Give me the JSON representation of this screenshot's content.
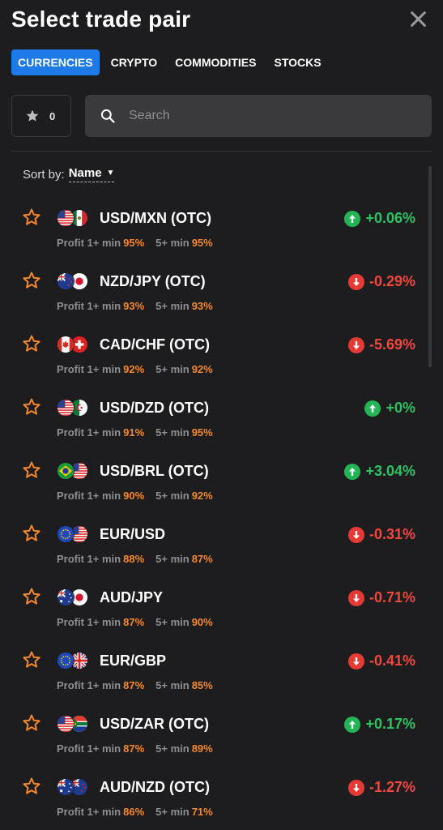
{
  "header": {
    "title": "Select trade pair"
  },
  "tabs": [
    {
      "label": "CURRENCIES",
      "active": true
    },
    {
      "label": "CRYPTO",
      "active": false
    },
    {
      "label": "COMMODITIES",
      "active": false
    },
    {
      "label": "STOCKS",
      "active": false
    }
  ],
  "favorites": {
    "count": "0"
  },
  "search": {
    "placeholder": "Search"
  },
  "sort": {
    "label": "Sort by:",
    "value": "Name"
  },
  "colors": {
    "accent": "#1d7ae6",
    "up": "#2ec262",
    "down": "#f2463f",
    "star": "#f5882c",
    "background": "#1d1d1f"
  },
  "pairs": [
    {
      "name": "USD/MXN (OTC)",
      "flags": [
        "us",
        "mx"
      ],
      "profit_label": "Profit 1+ min",
      "profit_1": "95%",
      "profit5_label": "5+ min",
      "profit_5": "95%",
      "change": "+0.06%",
      "direction": "up"
    },
    {
      "name": "NZD/JPY (OTC)",
      "flags": [
        "nz",
        "jp"
      ],
      "profit_label": "Profit 1+ min",
      "profit_1": "93%",
      "profit5_label": "5+ min",
      "profit_5": "93%",
      "change": "-0.29%",
      "direction": "down"
    },
    {
      "name": "CAD/CHF (OTC)",
      "flags": [
        "ca",
        "ch"
      ],
      "profit_label": "Profit 1+ min",
      "profit_1": "92%",
      "profit5_label": "5+ min",
      "profit_5": "92%",
      "change": "-5.69%",
      "direction": "down"
    },
    {
      "name": "USD/DZD (OTC)",
      "flags": [
        "us",
        "dz"
      ],
      "profit_label": "Profit 1+ min",
      "profit_1": "91%",
      "profit5_label": "5+ min",
      "profit_5": "95%",
      "change": "+0%",
      "direction": "up"
    },
    {
      "name": "USD/BRL (OTC)",
      "flags": [
        "br",
        "us"
      ],
      "profit_label": "Profit 1+ min",
      "profit_1": "90%",
      "profit5_label": "5+ min",
      "profit_5": "92%",
      "change": "+3.04%",
      "direction": "up"
    },
    {
      "name": "EUR/USD",
      "flags": [
        "eu",
        "us"
      ],
      "profit_label": "Profit 1+ min",
      "profit_1": "88%",
      "profit5_label": "5+ min",
      "profit_5": "87%",
      "change": "-0.31%",
      "direction": "down"
    },
    {
      "name": "AUD/JPY",
      "flags": [
        "au",
        "jp"
      ],
      "profit_label": "Profit 1+ min",
      "profit_1": "87%",
      "profit5_label": "5+ min",
      "profit_5": "90%",
      "change": "-0.71%",
      "direction": "down"
    },
    {
      "name": "EUR/GBP",
      "flags": [
        "eu",
        "gb"
      ],
      "profit_label": "Profit 1+ min",
      "profit_1": "87%",
      "profit5_label": "5+ min",
      "profit_5": "85%",
      "change": "-0.41%",
      "direction": "down"
    },
    {
      "name": "USD/ZAR (OTC)",
      "flags": [
        "us",
        "za"
      ],
      "profit_label": "Profit 1+ min",
      "profit_1": "87%",
      "profit5_label": "5+ min",
      "profit_5": "89%",
      "change": "+0.17%",
      "direction": "up"
    },
    {
      "name": "AUD/NZD (OTC)",
      "flags": [
        "au",
        "nz"
      ],
      "profit_label": "Profit 1+ min",
      "profit_1": "86%",
      "profit5_label": "5+ min",
      "profit_5": "71%",
      "change": "-1.27%",
      "direction": "down"
    }
  ]
}
